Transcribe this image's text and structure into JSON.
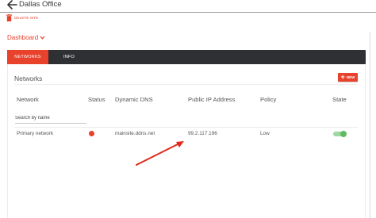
{
  "header": {
    "title": "Dallas Office"
  },
  "actions": {
    "delete_label": "DELETE SITE"
  },
  "view_selector": {
    "label": "Dashboard"
  },
  "tabs": [
    {
      "label": "NETWORKS",
      "active": true
    },
    {
      "label": "INFO",
      "active": false
    }
  ],
  "networks_section": {
    "title": "Networks",
    "new_button_label": "NEW",
    "columns": [
      "Network",
      "Status",
      "Dynamic DNS",
      "Public IP Address",
      "Policy",
      "State"
    ],
    "search_placeholder": "Search by name",
    "rows": [
      {
        "network": "Primary network",
        "status_color": "#e8412c",
        "dynamic_dns": "mainsite.ddns.net",
        "public_ip": "99.2.117.196",
        "policy": "Low",
        "state_on": true
      }
    ]
  },
  "colors": {
    "accent": "#e8412c",
    "tabbar": "#2e3034",
    "toggle_on": "#5fba62"
  },
  "icons": [
    "back-arrow-icon",
    "trash-icon",
    "chevron-down-icon",
    "plus-icon"
  ]
}
